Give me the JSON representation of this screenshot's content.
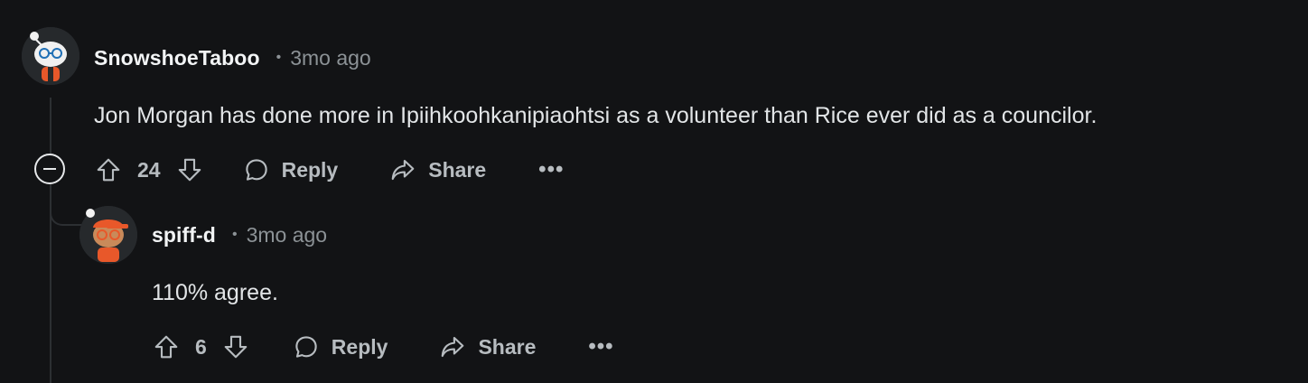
{
  "comments": [
    {
      "username": "SnowshoeTaboo",
      "separator": "•",
      "time": "3mo ago",
      "body": "Jon Morgan has done more in Ipiihkoohkanipiaohtsi as a volunteer than Rice ever did as a councilor.",
      "score": "24",
      "reply_label": "Reply",
      "share_label": "Share",
      "more_label": "•••"
    },
    {
      "username": "spiff-d",
      "separator": "•",
      "time": "3mo ago",
      "body": "110% agree.",
      "score": "6",
      "reply_label": "Reply",
      "share_label": "Share",
      "more_label": "•••"
    }
  ],
  "icons": {
    "upvote": "upvote-arrow-icon",
    "downvote": "downvote-arrow-icon",
    "reply": "speech-bubble-icon",
    "share": "share-arrow-icon",
    "collapse": "minus-circle-icon"
  },
  "colors": {
    "background": "#121315",
    "text": "#e2e5e7",
    "muted": "#8c9296",
    "avatar_accent": "#e8582a"
  }
}
